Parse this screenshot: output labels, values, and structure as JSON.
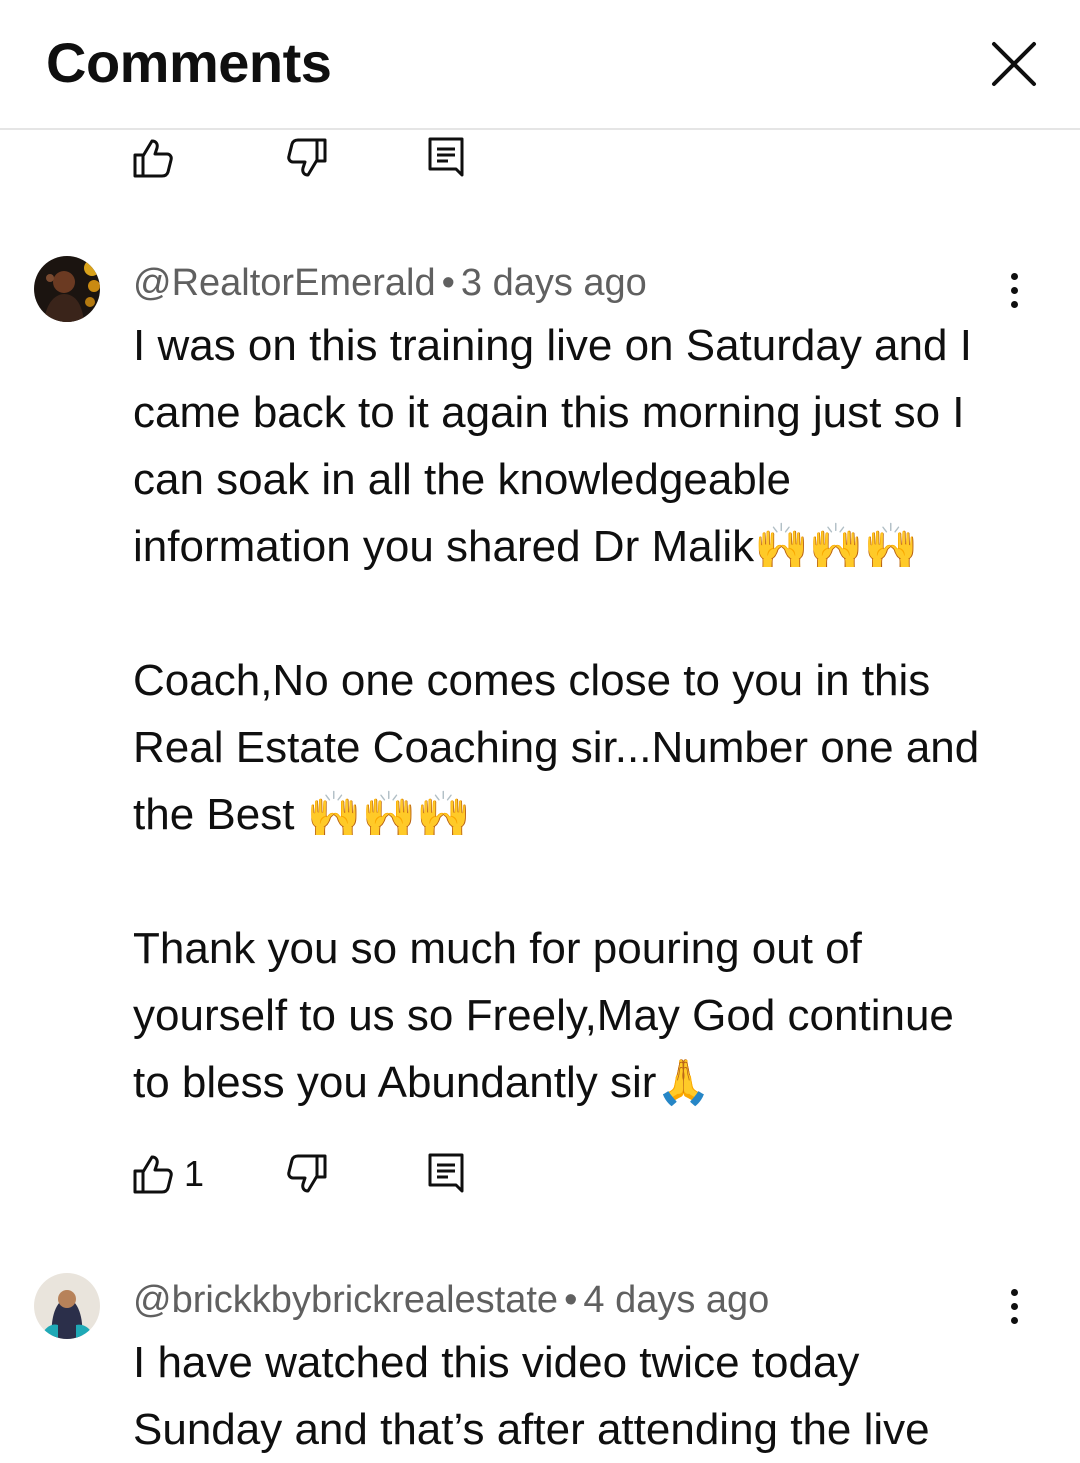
{
  "header": {
    "title": "Comments",
    "close_icon": "close-icon"
  },
  "comments": [
    {
      "author": "@RealtorEmerald",
      "separator": "•",
      "time": "3 days ago",
      "paragraphs": [
        [
          "I was on this training live on Saturday and I",
          "came back to it again this morning just so I",
          "can soak in all the knowledgeable",
          "information you shared Dr Malik🙌🙌🙌"
        ],
        [
          "Coach,No one comes close to you in this",
          "Real Estate Coaching sir...Number one and",
          "the Best 🙌🙌🙌"
        ],
        [
          "Thank you so much for pouring out of",
          "yourself to us so Freely,May God continue",
          "to bless you Abundantly sir🙏"
        ]
      ],
      "like_count": "1"
    },
    {
      "author": "@brickkbybrickrealestate",
      "separator": "•",
      "time": "4 days ago",
      "paragraphs": [
        [
          "I have watched this video twice today",
          "Sunday and that’s after attending the live"
        ]
      ]
    }
  ],
  "icons": {
    "like": "thumbs-up-icon",
    "dislike": "thumbs-down-icon",
    "reply": "reply-icon",
    "menu": "more-vert-icon"
  },
  "colors": {
    "text": "#0f0f0f",
    "secondary_text": "#606060",
    "divider": "#e5e5e5"
  }
}
